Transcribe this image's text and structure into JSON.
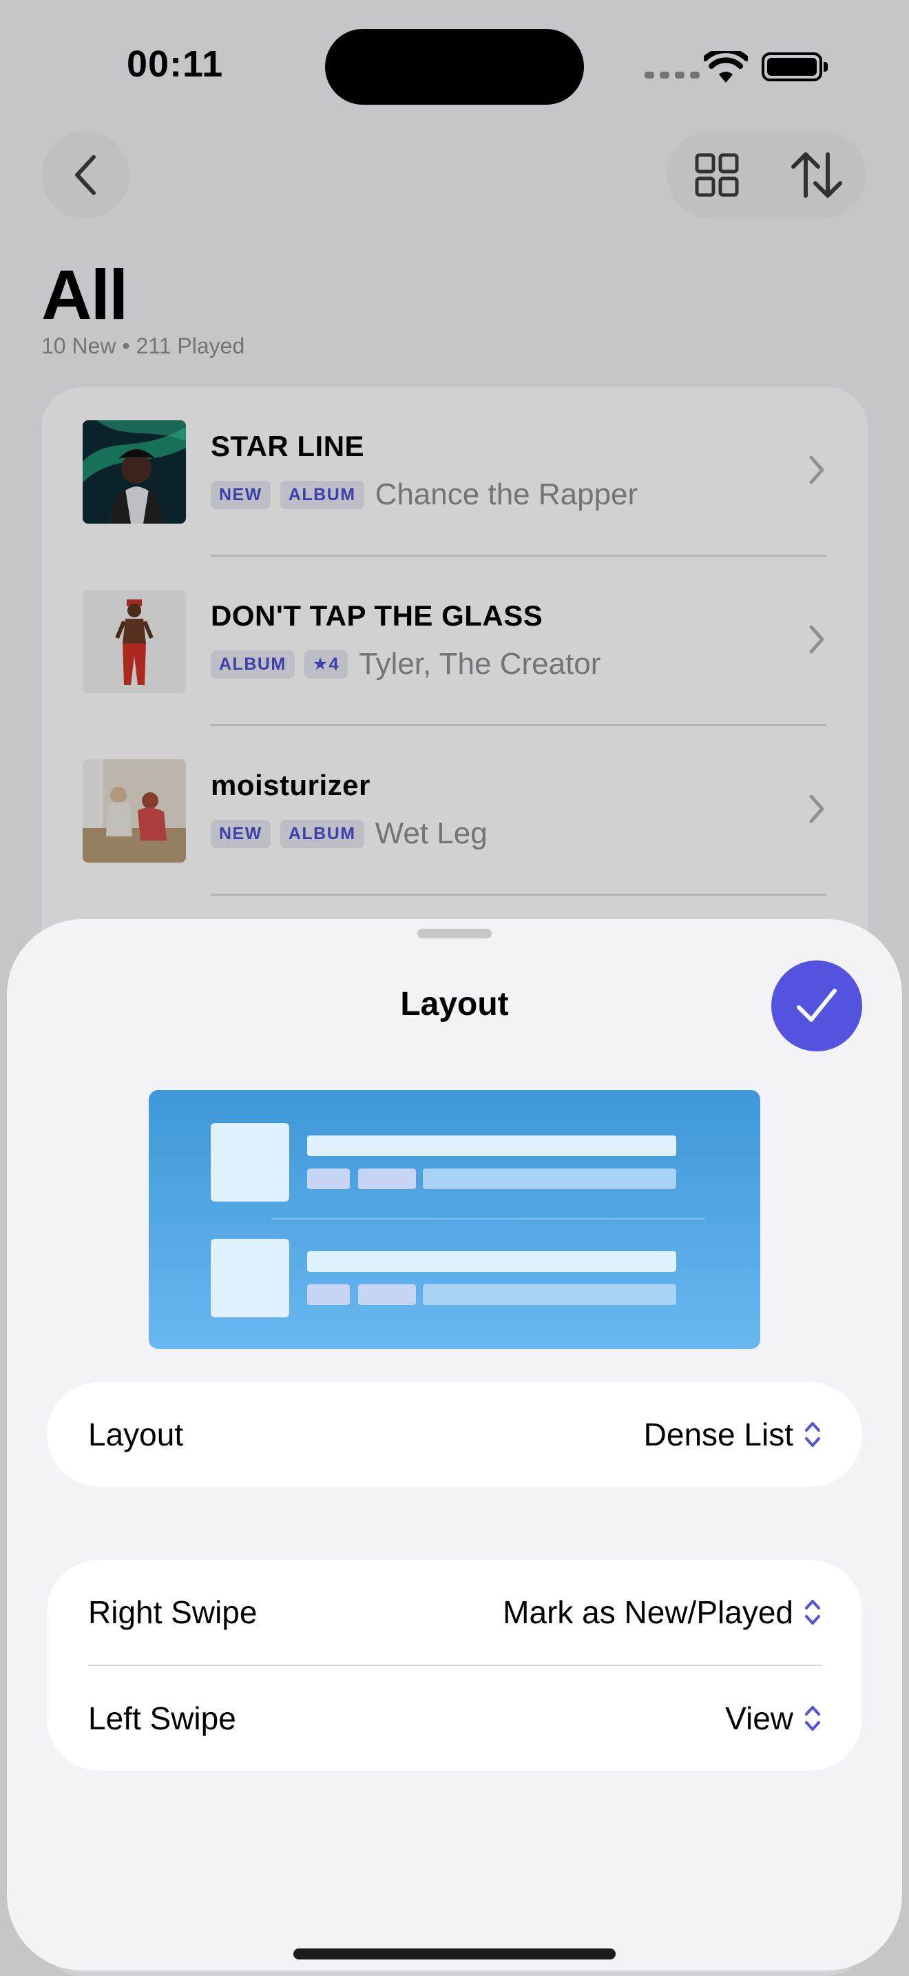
{
  "status_bar": {
    "time": "00:11"
  },
  "header": {
    "title": "All",
    "subtitle": "10 New • 211 Played"
  },
  "list": {
    "items": [
      {
        "title": "STAR LINE",
        "badges": [
          "NEW",
          "ALBUM"
        ],
        "artist": "Chance the Rapper"
      },
      {
        "title": "DON'T TAP THE GLASS",
        "badges": [
          "ALBUM",
          "★4"
        ],
        "artist": "Tyler, The Creator"
      },
      {
        "title": "moisturizer",
        "badges": [
          "NEW",
          "ALBUM"
        ],
        "artist": "Wet Leg"
      }
    ]
  },
  "sheet": {
    "title": "Layout",
    "layout_setting": {
      "label": "Layout",
      "value": "Dense List"
    },
    "swipe_settings": [
      {
        "label": "Right Swipe",
        "value": "Mark as New/Played"
      },
      {
        "label": "Left Swipe",
        "value": "View"
      }
    ]
  },
  "colors": {
    "accent": "#5353e0",
    "background": "#f2f2f7",
    "badge_text": "#4a4fd0",
    "secondary_text": "#8e8e93"
  },
  "icons": {
    "back": "chevron-left-icon",
    "grid": "grid-icon",
    "sort": "sort-arrows-icon",
    "row_chevron": "chevron-right-icon",
    "done": "checkmark-icon",
    "picker": "chevron-up-down-icon"
  }
}
